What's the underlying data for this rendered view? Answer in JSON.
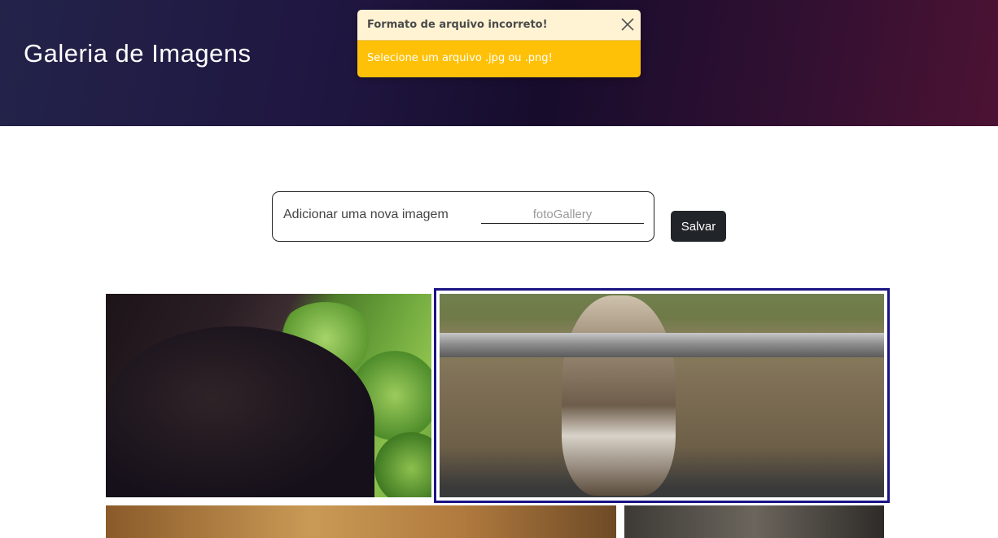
{
  "header": {
    "title": "Galeria de Imagens"
  },
  "toast": {
    "title": "Formato de arquivo incorreto!",
    "message": "Selecione um arquivo .jpg ou .png!",
    "close_icon": "close-icon",
    "colors": {
      "header_bg": "#fff3d4",
      "body_bg": "#ffc107"
    }
  },
  "upload": {
    "label": "Adicionar uma nova imagem",
    "placeholder": "fotoGallery",
    "save_label": "Salvar"
  },
  "gallery": {
    "images": [
      {
        "alt": "black cat among plants"
      },
      {
        "alt": "cat hanging on metal rail",
        "selected": true
      },
      {
        "alt": "cat image"
      },
      {
        "alt": "cat image"
      }
    ],
    "selected_border_color": "#1a1483"
  },
  "colors": {
    "button_bg": "#212529"
  }
}
